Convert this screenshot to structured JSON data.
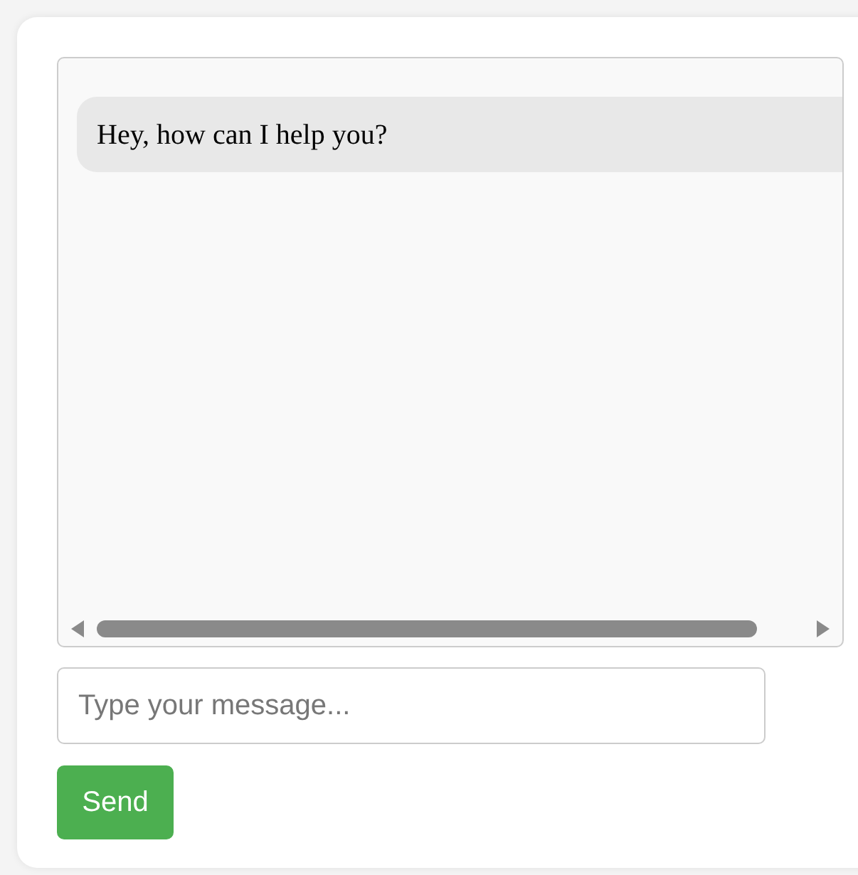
{
  "messages": [
    {
      "kind": "bot",
      "text": "Hey, how can I help you?"
    }
  ],
  "input": {
    "placeholder": "Type your message..."
  },
  "send_button": {
    "label": "Send"
  }
}
